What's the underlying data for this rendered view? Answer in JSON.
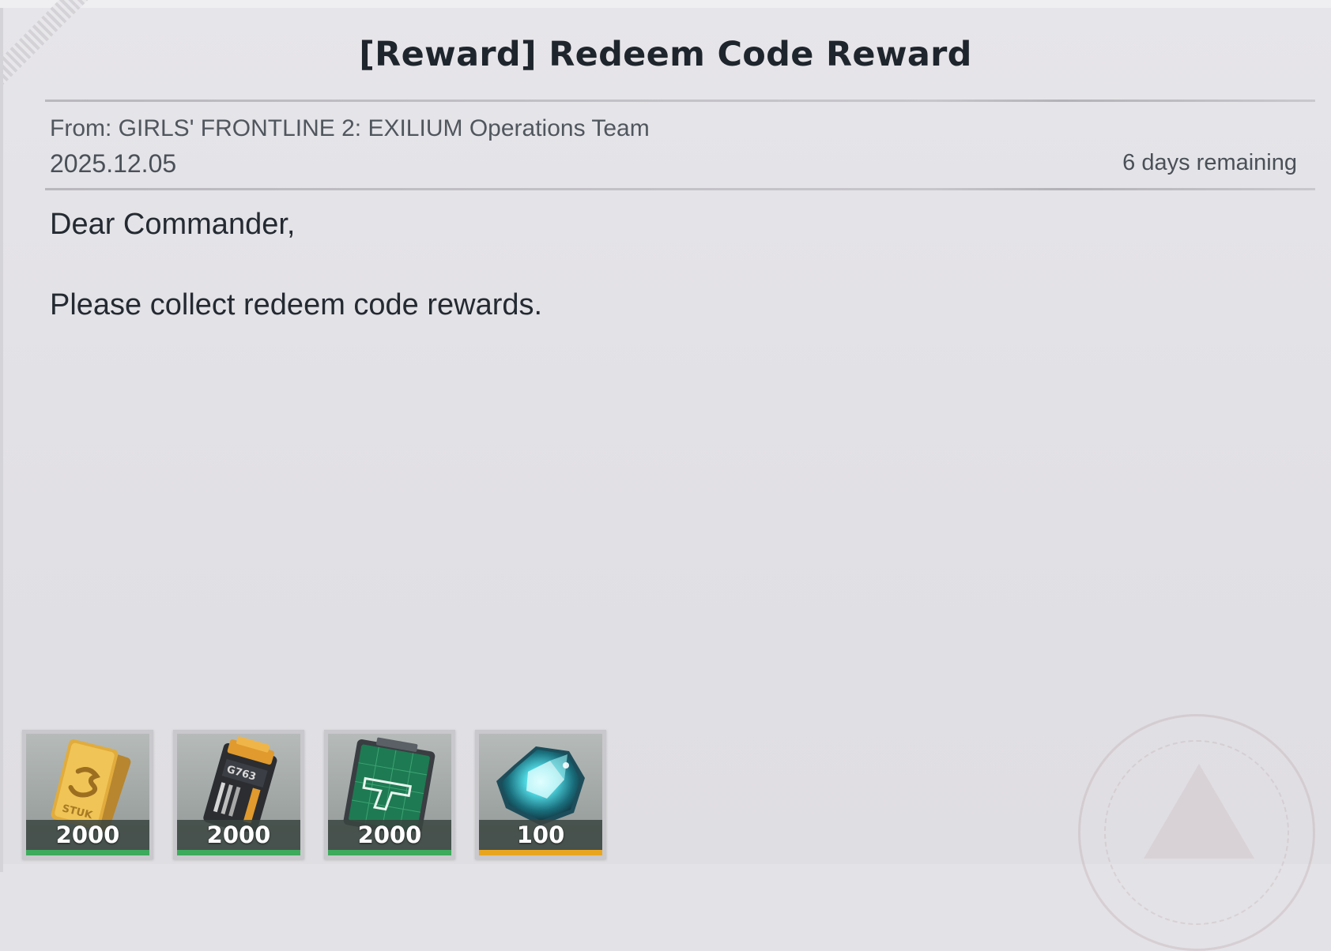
{
  "mail": {
    "title": "[Reward] Redeem Code Reward",
    "from": "From: GIRLS' FRONTLINE 2: EXILIUM Operations Team",
    "date": "2025.12.05",
    "remaining": "6 days remaining",
    "greeting": "Dear Commander,",
    "message": "Please collect redeem code rewards."
  },
  "rewards": [
    {
      "icon": "gold-credit-card-icon",
      "count": "2000",
      "rarity_color": "#3daa5c"
    },
    {
      "icon": "battery-cell-icon",
      "count": "2000",
      "rarity_color": "#3daa5c"
    },
    {
      "icon": "weapon-blueprint-icon",
      "count": "2000",
      "rarity_color": "#3daa5c"
    },
    {
      "icon": "crystal-gem-icon",
      "count": "100",
      "rarity_color": "#e8a620"
    }
  ],
  "colors": {
    "background": "#e3e2e6",
    "text": "#242a32",
    "meta_text": "#50565e"
  }
}
